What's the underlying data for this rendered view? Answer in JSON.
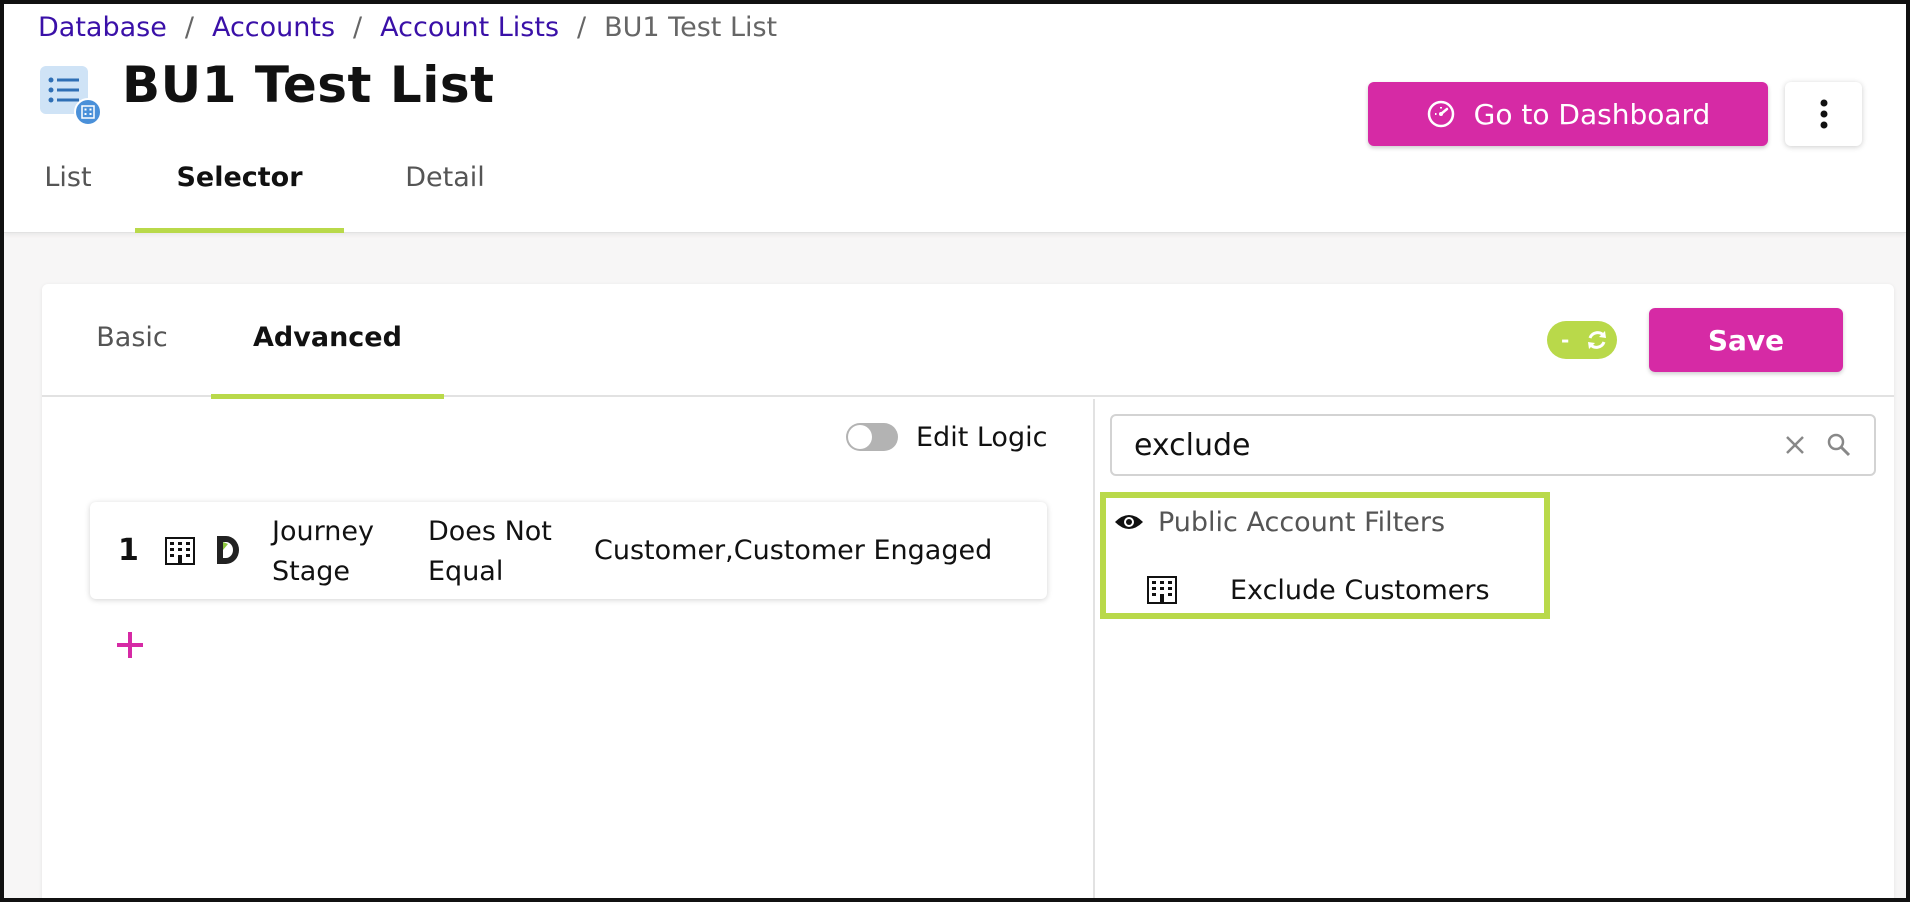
{
  "breadcrumb": {
    "items": [
      "Database",
      "Accounts",
      "Account Lists"
    ],
    "separator": "/",
    "current": "BU1 Test List"
  },
  "page": {
    "title": "BU1 Test List",
    "tabs": [
      "List",
      "Selector",
      "Detail"
    ],
    "active_tab": "Selector"
  },
  "header_actions": {
    "dashboard_label": "Go to Dashboard",
    "more_icon": "vertical-dots-icon"
  },
  "selector": {
    "tabs": [
      "Basic",
      "Advanced"
    ],
    "active_tab": "Advanced",
    "refresh_toggle_label": "-",
    "save_label": "Save",
    "edit_logic_label": "Edit Logic",
    "edit_logic_on": false,
    "rules": [
      {
        "index": "1",
        "icon": "building-icon",
        "source_icon": "d-logo-icon",
        "field": "Journey Stage",
        "operator": "Does Not Equal",
        "value": "Customer,Customer Engaged"
      }
    ],
    "add_icon": "plus-icon"
  },
  "search": {
    "value": "exclude",
    "results": {
      "group_label": "Public Account Filters",
      "group_icon": "eye-icon",
      "items": [
        {
          "icon": "building-icon",
          "label": "Exclude Customers"
        }
      ]
    }
  },
  "colors": {
    "brand_magenta": "#d62aa5",
    "accent_green": "#b9d94a",
    "link_purple": "#3a10a8"
  }
}
